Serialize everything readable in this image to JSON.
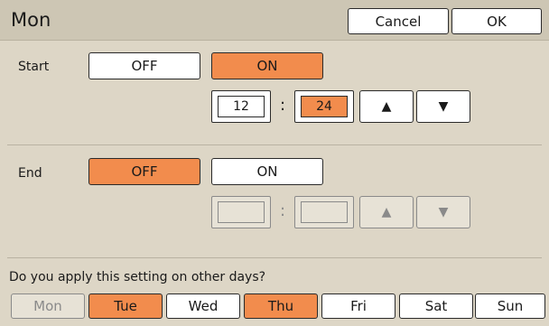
{
  "dialog": {
    "title": "Mon",
    "cancel_label": "Cancel",
    "ok_label": "OK"
  },
  "start": {
    "label": "Start",
    "off_label": "OFF",
    "on_label": "ON",
    "selected": "ON",
    "hour": "12",
    "minute": "24",
    "separator": ":",
    "up_icon": "up-triangle-icon",
    "down_icon": "down-triangle-icon",
    "up_glyph": "▲",
    "down_glyph": "▼"
  },
  "end": {
    "label": "End",
    "off_label": "OFF",
    "on_label": "ON",
    "selected": "OFF",
    "hour": "",
    "minute": "",
    "separator": ":",
    "up_glyph": "▲",
    "down_glyph": "▼"
  },
  "apply": {
    "question": "Do you apply this setting on other days?",
    "days": [
      {
        "label": "Mon",
        "state": "disabled"
      },
      {
        "label": "Tue",
        "state": "selected"
      },
      {
        "label": "Wed",
        "state": "normal"
      },
      {
        "label": "Thu",
        "state": "selected"
      },
      {
        "label": "Fri",
        "state": "normal"
      },
      {
        "label": "Sat",
        "state": "normal"
      },
      {
        "label": "Sun",
        "state": "normal"
      }
    ]
  },
  "colors": {
    "background": "#ddd6c6",
    "selected": "#f28c4d",
    "button": "#ffffff",
    "disabled_text": "#8a8a8a"
  }
}
